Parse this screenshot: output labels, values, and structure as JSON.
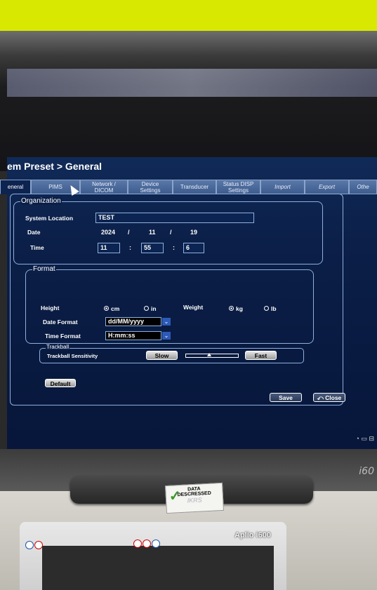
{
  "title": "em Preset > General",
  "tabs": [
    {
      "label": "eneral",
      "active": true
    },
    {
      "label": "PIMS"
    },
    {
      "label": "Network /\nDICOM"
    },
    {
      "label": "Device\nSettings"
    },
    {
      "label": "Transducer"
    },
    {
      "label": "Status DISP\nSettings"
    },
    {
      "label": "Import",
      "italic": true
    },
    {
      "label": "Export",
      "italic": true
    },
    {
      "label": "Othe",
      "italic": true
    }
  ],
  "organization": {
    "legend": "Organization",
    "system_location_label": "System Location",
    "system_location_value": "TEST",
    "date_label": "Date",
    "date_year": "2024",
    "date_sep1": "/",
    "date_month": "11",
    "date_sep2": "/",
    "date_day": "19",
    "time_label": "Time",
    "time_hour": "11",
    "time_sep1": ":",
    "time_min": "55",
    "time_sep2": ":",
    "time_sec": "6"
  },
  "format": {
    "legend": "Format",
    "height_label": "Height",
    "height_opt1": "cm",
    "height_opt2": "in",
    "weight_label": "Weight",
    "weight_opt1": "kg",
    "weight_opt2": "lb",
    "date_format_label": "Date Format",
    "date_format_value": "dd/MM/yyyy",
    "time_format_label": "Time Format",
    "time_format_value": "H:mm:ss"
  },
  "trackball": {
    "legend": "Trackball",
    "sensitivity_label": "Trackball Sensitivity",
    "slow_label": "Slow",
    "fast_label": "Fast"
  },
  "buttons": {
    "default_label": "Default",
    "save_label": "Save",
    "close_label": "Close"
  },
  "device": {
    "model_logo": "i60",
    "cart_brand": "Aplio i600",
    "sticker_line1": "DATA",
    "sticker_line2": "DESCRESSED",
    "sticker_line3": "IKRS"
  },
  "colors": {
    "screen_bg": "#0b1f48",
    "border": "#8fb0dc",
    "tab": "#4a6a9c",
    "wall": "#d8e800"
  }
}
